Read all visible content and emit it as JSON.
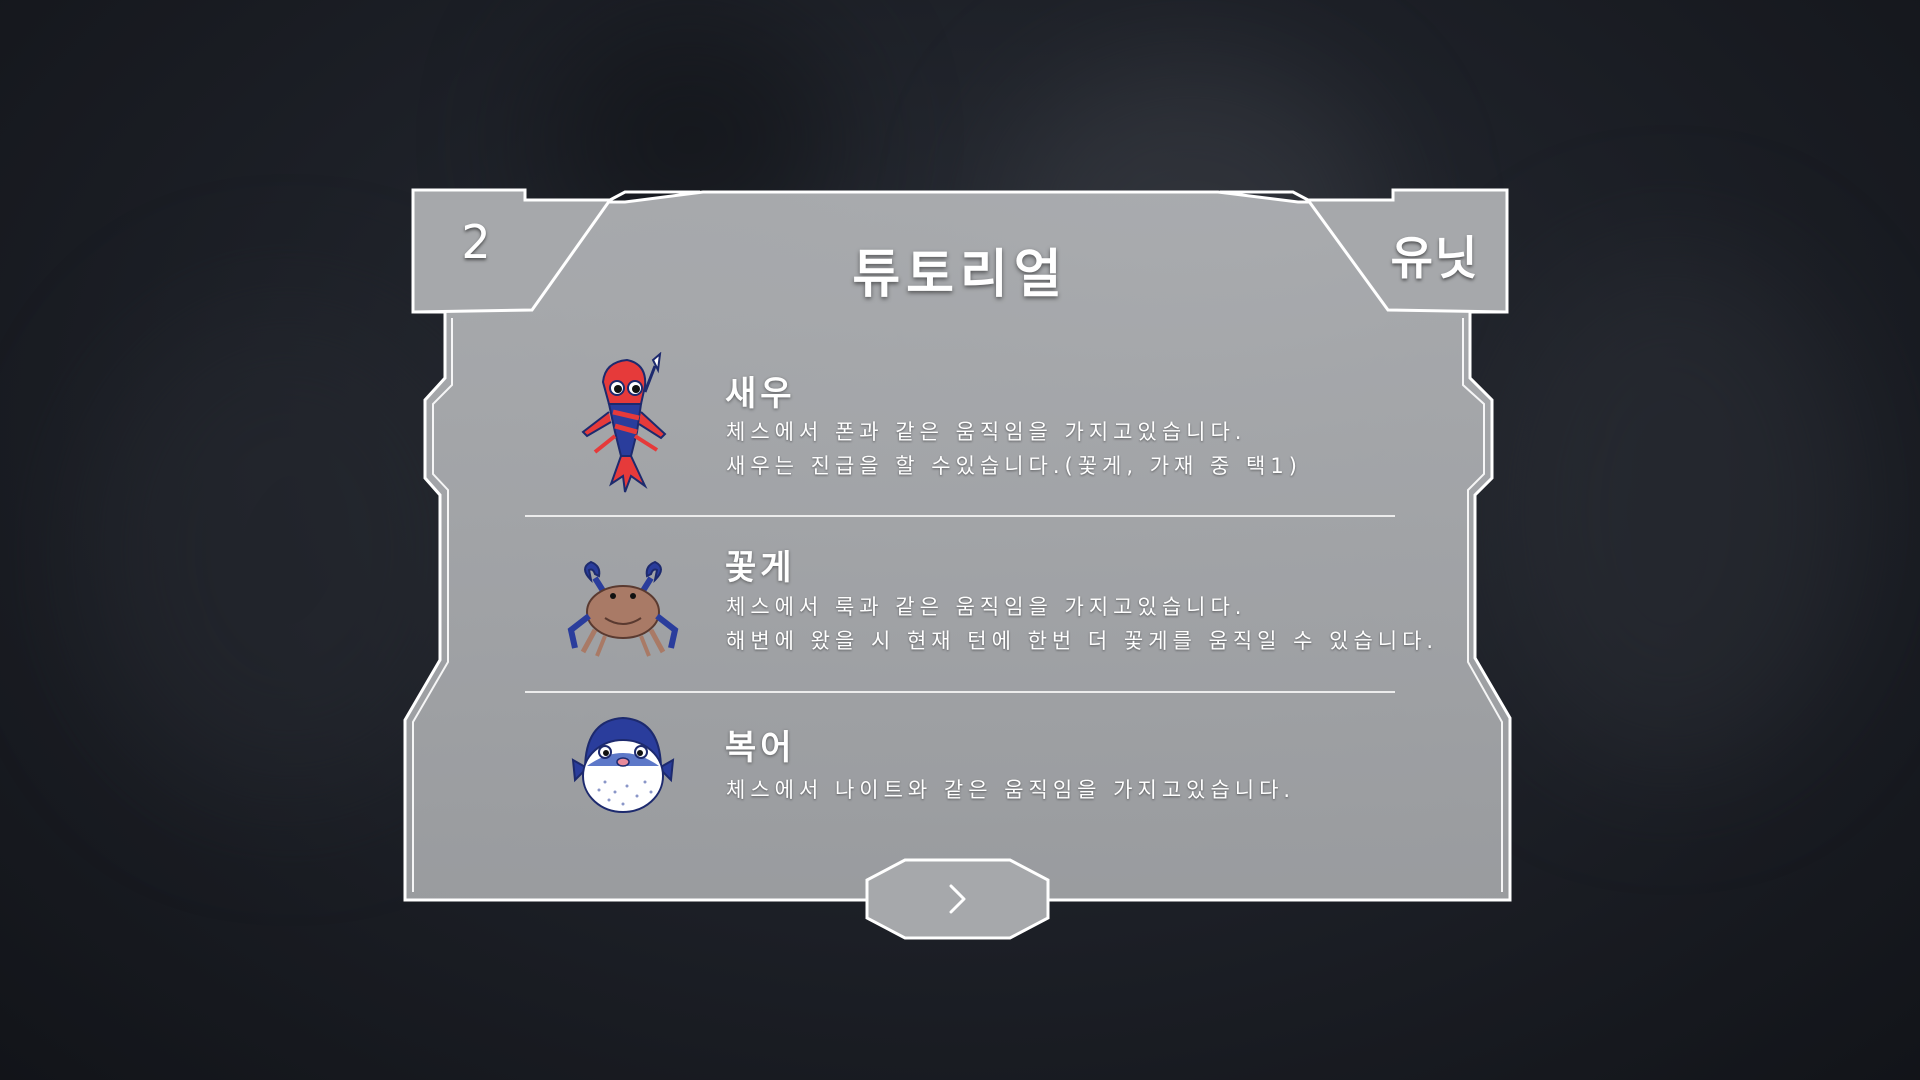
{
  "header": {
    "page_number": "2",
    "title": "튜토리얼",
    "section": "유닛"
  },
  "units": [
    {
      "name": "새우",
      "icon": "shrimp-icon",
      "desc_line1": "체스에서 폰과 같은 움직임을 가지고있습니다.",
      "desc_line2": "새우는 진급을 할 수있습니다.(꽃게, 가재 중 택1)"
    },
    {
      "name": "꽃게",
      "icon": "crab-icon",
      "desc_line1": "체스에서 룩과 같은 움직임을 가지고있습니다.",
      "desc_line2": "해변에 왔을 시 현재 턴에 한번 더 꽃게를 움직일 수 있습니다."
    },
    {
      "name": "복어",
      "icon": "pufferfish-icon",
      "desc_line1": "체스에서 나이트와 같은 움직임을 가지고있습니다."
    }
  ],
  "footer": {
    "next_icon": "chevron-right-icon"
  },
  "colors": {
    "panel_fill": "#a9abae",
    "panel_border": "#ffffff",
    "background": "#1c1f26"
  }
}
